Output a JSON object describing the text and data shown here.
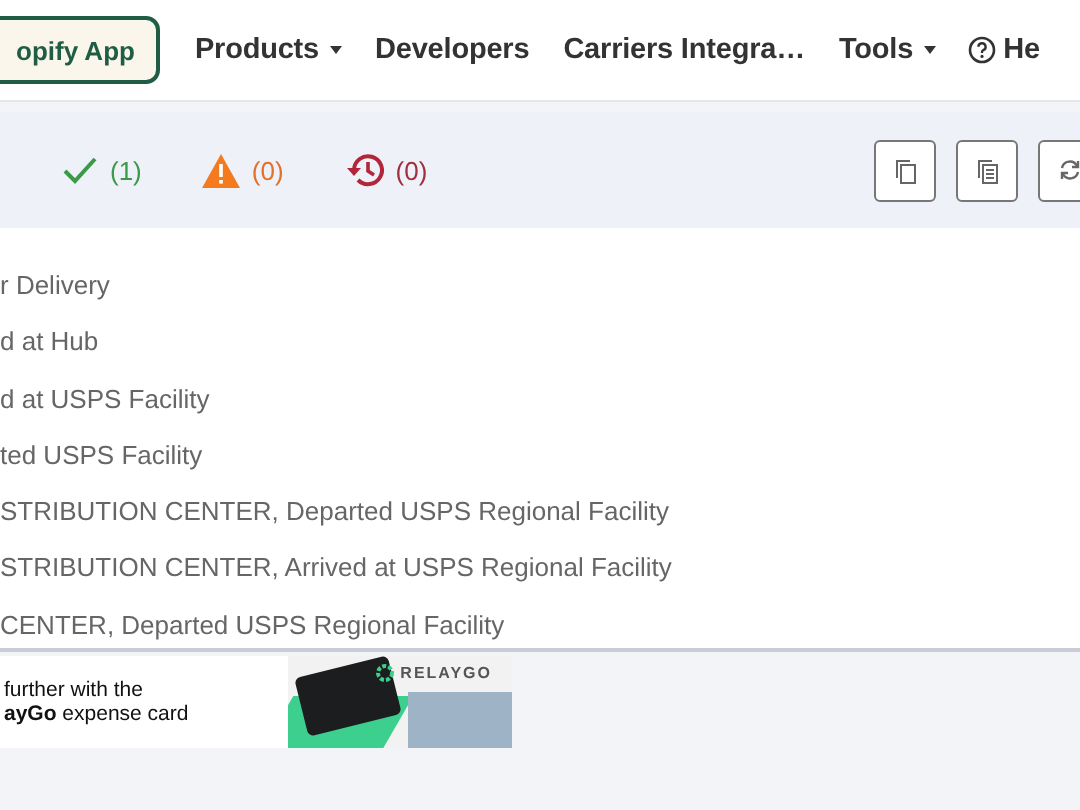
{
  "nav": {
    "app_button": "opify App",
    "items": [
      {
        "label": "Products",
        "dropdown": true
      },
      {
        "label": "Developers",
        "dropdown": false
      },
      {
        "label": "Carriers Integra…",
        "dropdown": false
      },
      {
        "label": "Tools",
        "dropdown": true
      }
    ],
    "help": "He"
  },
  "status_counts": [
    {
      "kind": "success",
      "count": "(1)"
    },
    {
      "kind": "warning",
      "count": "(0)"
    },
    {
      "kind": "expired",
      "count": "(0)"
    }
  ],
  "events": [
    "r Delivery",
    "d at Hub",
    "d at USPS Facility",
    "ted USPS Facility",
    "STRIBUTION CENTER, Departed USPS Regional Facility",
    "STRIBUTION CENTER, Arrived at USPS Regional Facility",
    "CENTER, Departed USPS Regional Facility"
  ],
  "ad": {
    "line_1": "further with the",
    "line_2": "**ayGo** expense card",
    "brand": "RELAYGO"
  }
}
